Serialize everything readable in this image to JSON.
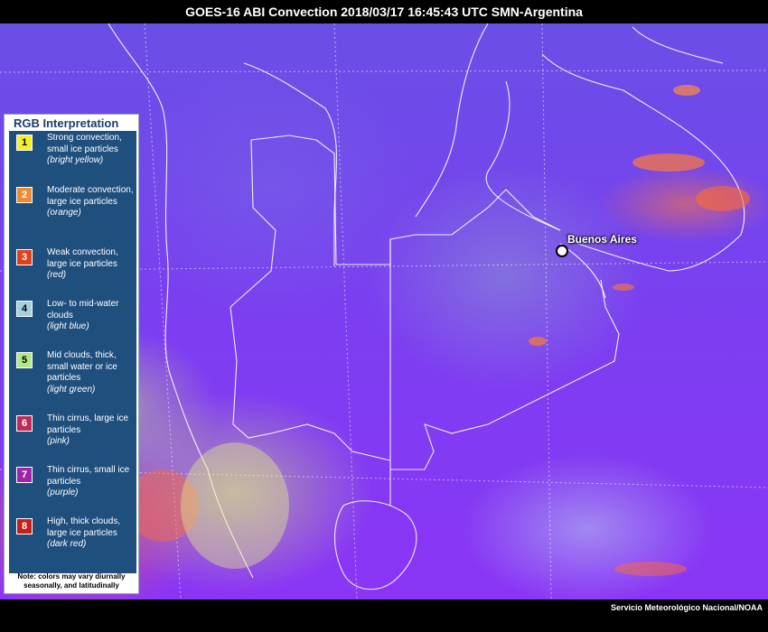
{
  "header": {
    "title": "GOES-16 ABI Convection 2018/03/17 16:45:43 UTC SMN-Argentina"
  },
  "map": {
    "city_label": "Buenos Aires"
  },
  "legend": {
    "title": "RGB Interpretation",
    "items": [
      {
        "number": "1",
        "color": "#f4f02a",
        "text": "Strong convection, small ice particles",
        "note": "(bright yellow)"
      },
      {
        "number": "2",
        "color": "#f08a30",
        "text": "Moderate convection, large ice particles",
        "note": "(orange)"
      },
      {
        "number": "3",
        "color": "#e0401c",
        "text": "Weak convection, large ice particles",
        "note": "(red)"
      },
      {
        "number": "4",
        "color": "#a6cfe0",
        "text": "Low- to mid-water clouds",
        "note": "(light blue)"
      },
      {
        "number": "5",
        "color": "#b4e886",
        "text": "Mid clouds, thick, small water or ice particles",
        "note": "(light green)"
      },
      {
        "number": "6",
        "color": "#c02a5a",
        "text": "Thin cirrus, large ice particles",
        "note": "(pink)"
      },
      {
        "number": "7",
        "color": "#a024a6",
        "text": "Thin cirrus, small ice particles",
        "note": "(purple)"
      },
      {
        "number": "8",
        "color": "#c81e18",
        "text": "High, thick clouds, large ice particles",
        "note": "(dark red)"
      }
    ],
    "note": "Note: colors may vary diurnally seasonally, and latitudinally"
  },
  "footer": {
    "credit": "Servicio Meteorológico Nacional/NOAA"
  }
}
